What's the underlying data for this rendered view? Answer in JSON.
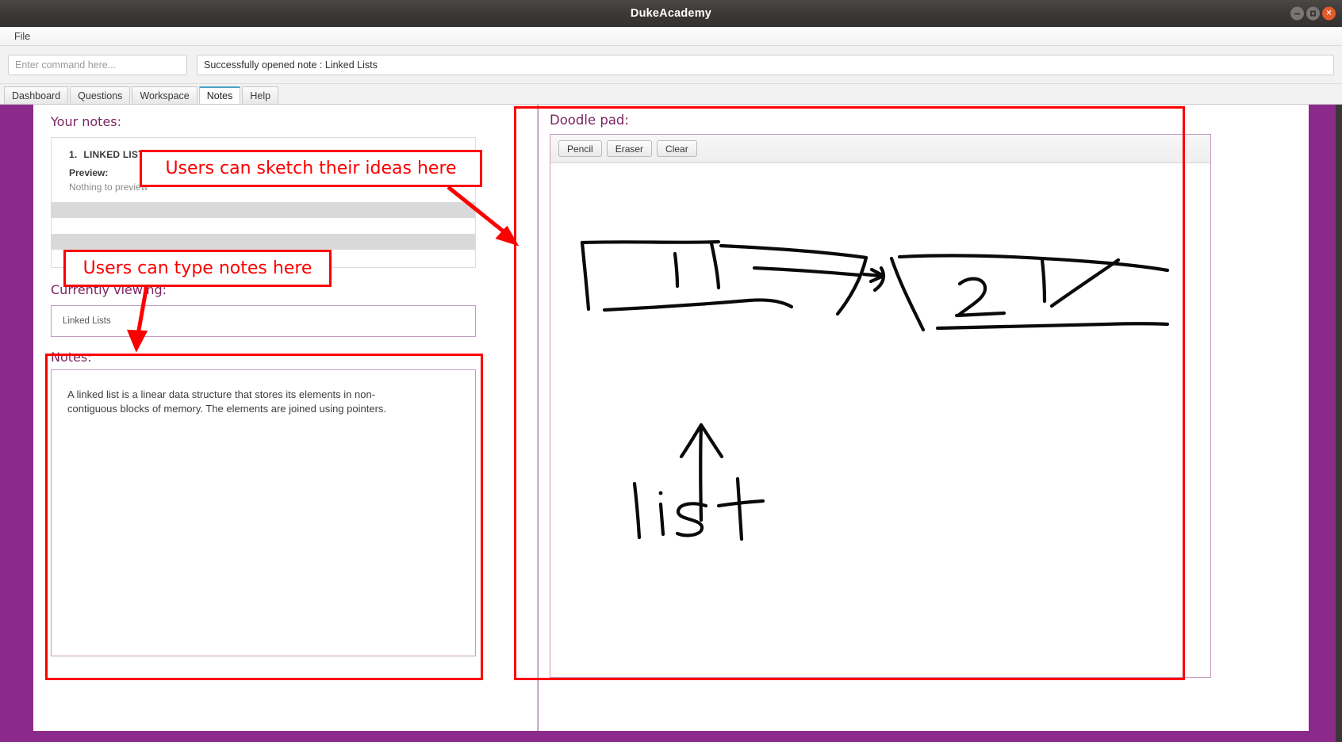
{
  "window": {
    "title": "DukeAcademy",
    "controls": [
      {
        "name": "minimize",
        "glyph": "minus"
      },
      {
        "name": "maximize",
        "glyph": "square"
      },
      {
        "name": "close",
        "glyph": "x"
      }
    ]
  },
  "menubar": {
    "items": [
      "File"
    ]
  },
  "command": {
    "placeholder": "Enter command here...",
    "value": "",
    "result": "Successfully opened note : Linked Lists"
  },
  "tabs": [
    {
      "label": "Dashboard",
      "active": false
    },
    {
      "label": "Questions",
      "active": false
    },
    {
      "label": "Workspace",
      "active": false
    },
    {
      "label": "Notes",
      "active": true
    },
    {
      "label": "Help",
      "active": false
    }
  ],
  "left": {
    "your_notes_heading": "Your notes:",
    "notes_list": [
      {
        "number": "1.",
        "title": "LINKED LISTS",
        "preview_label": "Preview:",
        "preview_text": "Nothing to preview"
      }
    ],
    "currently_viewing_heading": "Currently viewing:",
    "currently_viewing_value": "Linked Lists",
    "notes_heading": "Notes:",
    "notes_body": "A linked list is a linear data structure that stores its elements in non-contiguous blocks of memory. The elements are joined using pointers."
  },
  "right": {
    "doodle_heading": "Doodle pad:",
    "tools": [
      {
        "label": "Pencil"
      },
      {
        "label": "Eraser"
      },
      {
        "label": "Clear"
      }
    ],
    "doodle_sketch_text": "list"
  },
  "annotations": [
    {
      "id": "sketch-callout",
      "text": "Users can sketch their ideas here"
    },
    {
      "id": "type-callout",
      "text": "Users can type notes here"
    }
  ],
  "colors": {
    "accent_purple": "#7b2462",
    "sidebar_purple": "#8c2a8c",
    "annotation_red": "#fc0000",
    "tab_active_border": "#4aa3c7",
    "titlebar": "#3c3835",
    "close_button": "#e25b2a"
  }
}
